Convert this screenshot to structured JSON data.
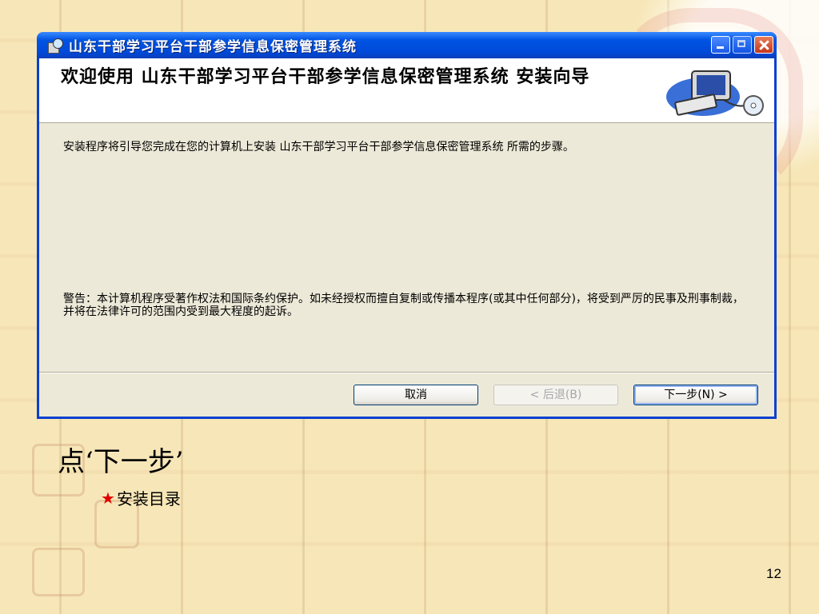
{
  "window": {
    "title": "山东干部学习平台干部参学信息保密管理系统",
    "header_title": "欢迎使用 山东干部学习平台干部参学信息保密管理系统 安装向导",
    "intro_text": "安装程序将引导您完成在您的计算机上安装 山东干部学习平台干部参学信息保密管理系统 所需的步骤。",
    "warning_text": "警告：本计算机程序受著作权法和国际条约保护。如未经授权而擅自复制或传播本程序(或其中任何部分)，将受到严厉的民事及刑事制裁，并将在法律许可的范围内受到最大程度的起诉。",
    "buttons": {
      "cancel": "取消",
      "back": "< 后退(B)",
      "next": "下一步(N) >"
    }
  },
  "slide": {
    "caption": "点‘下一步’",
    "bullet_star": "★",
    "bullet_text": "安装目录",
    "page_number": "12"
  },
  "colors": {
    "titlebar": "#0054e3",
    "slide_background": "#f7e7b8",
    "bullet_star": "#e00000"
  }
}
